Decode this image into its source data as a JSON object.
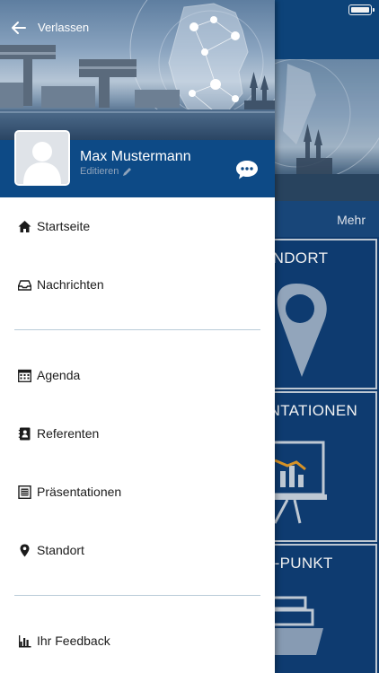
{
  "background_app": {
    "more_label": "Mehr",
    "tiles": [
      {
        "title": "ANDORT",
        "icon": "map-pin-icon"
      },
      {
        "title": "ENTATIONEN",
        "icon": "presentation-board-icon"
      },
      {
        "title": "S-PUNKT",
        "icon": "ship-icon"
      }
    ]
  },
  "drawer": {
    "back_label": "Verlassen",
    "user": {
      "name": "Max Mustermann",
      "edit_label": "Editieren"
    },
    "menu": [
      {
        "label": "Startseite",
        "icon": "home-icon"
      },
      {
        "label": "Nachrichten",
        "icon": "inbox-icon"
      },
      {
        "label": "Agenda",
        "icon": "calendar-icon"
      },
      {
        "label": "Referenten",
        "icon": "contacts-book-icon"
      },
      {
        "label": "Präsentationen",
        "icon": "document-icon"
      },
      {
        "label": "Standort",
        "icon": "location-pin-icon"
      },
      {
        "label": "Ihr Feedback",
        "icon": "bar-chart-icon"
      }
    ]
  },
  "colors": {
    "primary": "#0d4a86",
    "tile_bg": "#0f3f77",
    "drawer_bg": "#ffffff",
    "divider": "#b9cbd8"
  }
}
